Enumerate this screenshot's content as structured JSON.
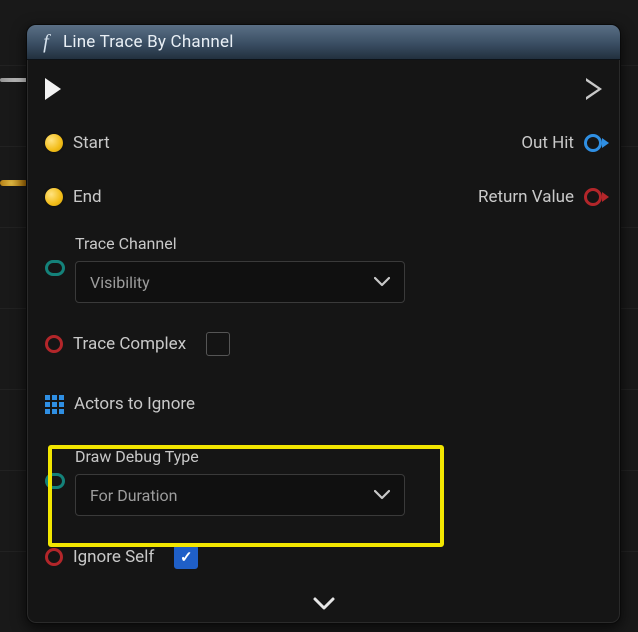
{
  "node": {
    "title": "Line Trace By Channel",
    "inputs": {
      "start": {
        "label": "Start"
      },
      "end": {
        "label": "End"
      },
      "traceChannel": {
        "label": "Trace Channel",
        "value": "Visibility"
      },
      "traceComplex": {
        "label": "Trace Complex",
        "checked": false
      },
      "actorsToIgnore": {
        "label": "Actors to Ignore"
      },
      "drawDebugType": {
        "label": "Draw Debug Type",
        "value": "For Duration"
      },
      "ignoreSelf": {
        "label": "Ignore Self",
        "checked": true
      }
    },
    "outputs": {
      "outHit": {
        "label": "Out Hit"
      },
      "returnValue": {
        "label": "Return Value"
      }
    }
  }
}
